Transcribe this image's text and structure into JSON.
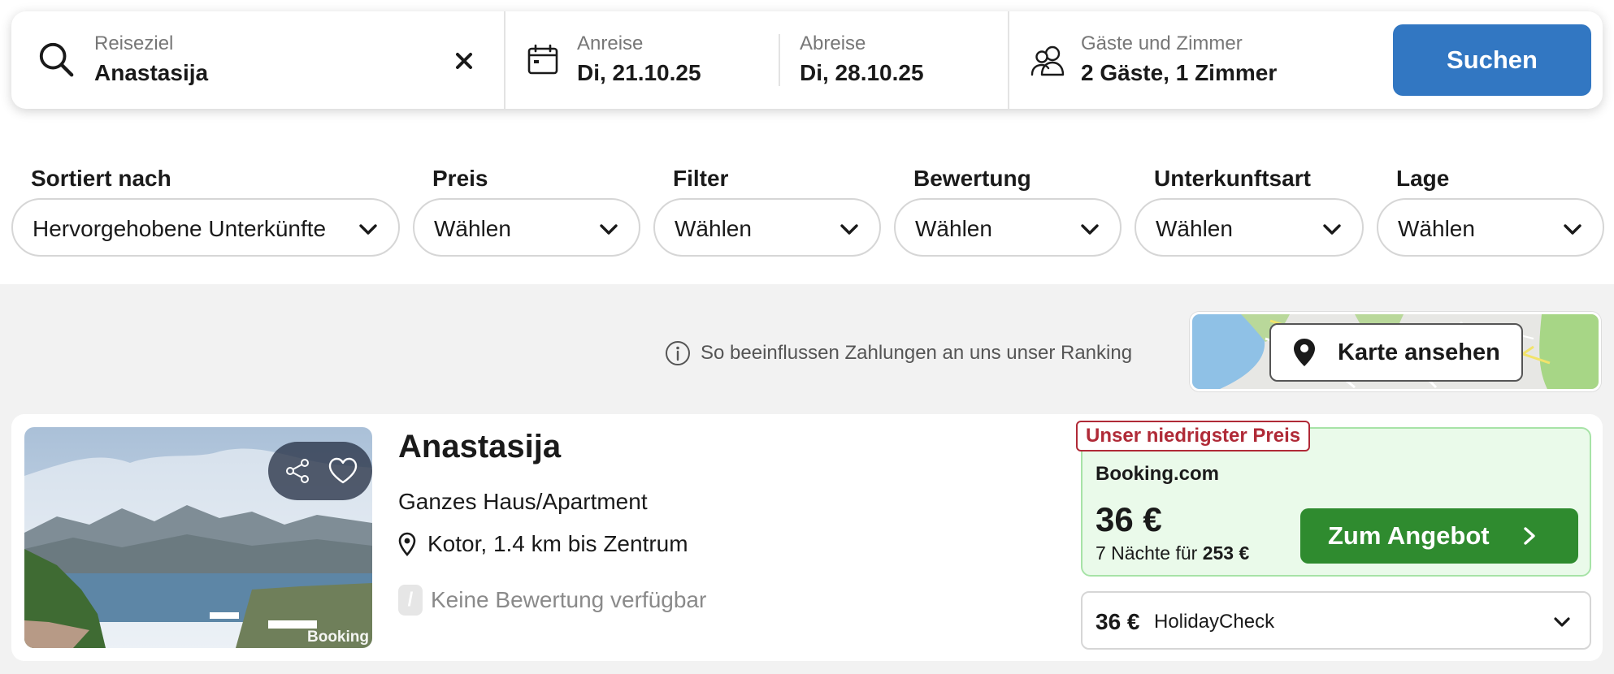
{
  "search": {
    "destination_label": "Reiseziel",
    "destination_value": "Anastasija",
    "checkin_label": "Anreise",
    "checkin_value": "Di, 21.10.25",
    "checkout_label": "Abreise",
    "checkout_value": "Di, 28.10.25",
    "guests_label": "Gäste und Zimmer",
    "guests_value": "2 Gäste, 1 Zimmer",
    "search_button": "Suchen"
  },
  "filters": [
    {
      "label": "Sortiert nach",
      "value": "Hervorgehobene Unterkünfte"
    },
    {
      "label": "Preis",
      "value": "Wählen"
    },
    {
      "label": "Filter",
      "value": "Wählen"
    },
    {
      "label": "Bewertung",
      "value": "Wählen"
    },
    {
      "label": "Unterkunftsart",
      "value": "Wählen"
    },
    {
      "label": "Lage",
      "value": "Wählen"
    }
  ],
  "ranking_info": "So beeinflussen Zahlungen an uns unser Ranking",
  "map_button": "Karte ansehen",
  "result": {
    "name": "Anastasija",
    "type": "Ganzes Haus/Apartment",
    "location": "Kotor, 1.4 km bis Zentrum",
    "rating_badge": "/",
    "rating_text": "Keine Bewertung verfügbar",
    "photo_watermark": "Booking",
    "deal_badge": "Unser niedrigster Preis",
    "provider": "Booking.com",
    "price": "36 €",
    "nights_prefix": "7 Nächte für",
    "nights_total": "253 €",
    "offer_button": "Zum Angebot",
    "alt_price": "36 €",
    "alt_provider": "HolidayCheck"
  },
  "colors": {
    "primary_blue": "#3277c2",
    "offer_green": "#2f8b2f",
    "deal_bg": "#eafaea",
    "badge_red": "#b02a37"
  },
  "icons": [
    "search-icon",
    "clear-icon",
    "calendar-icon",
    "guests-icon",
    "chevron-down-icon",
    "info-icon",
    "map-pin-icon",
    "share-icon",
    "heart-icon",
    "chevron-right-icon"
  ]
}
